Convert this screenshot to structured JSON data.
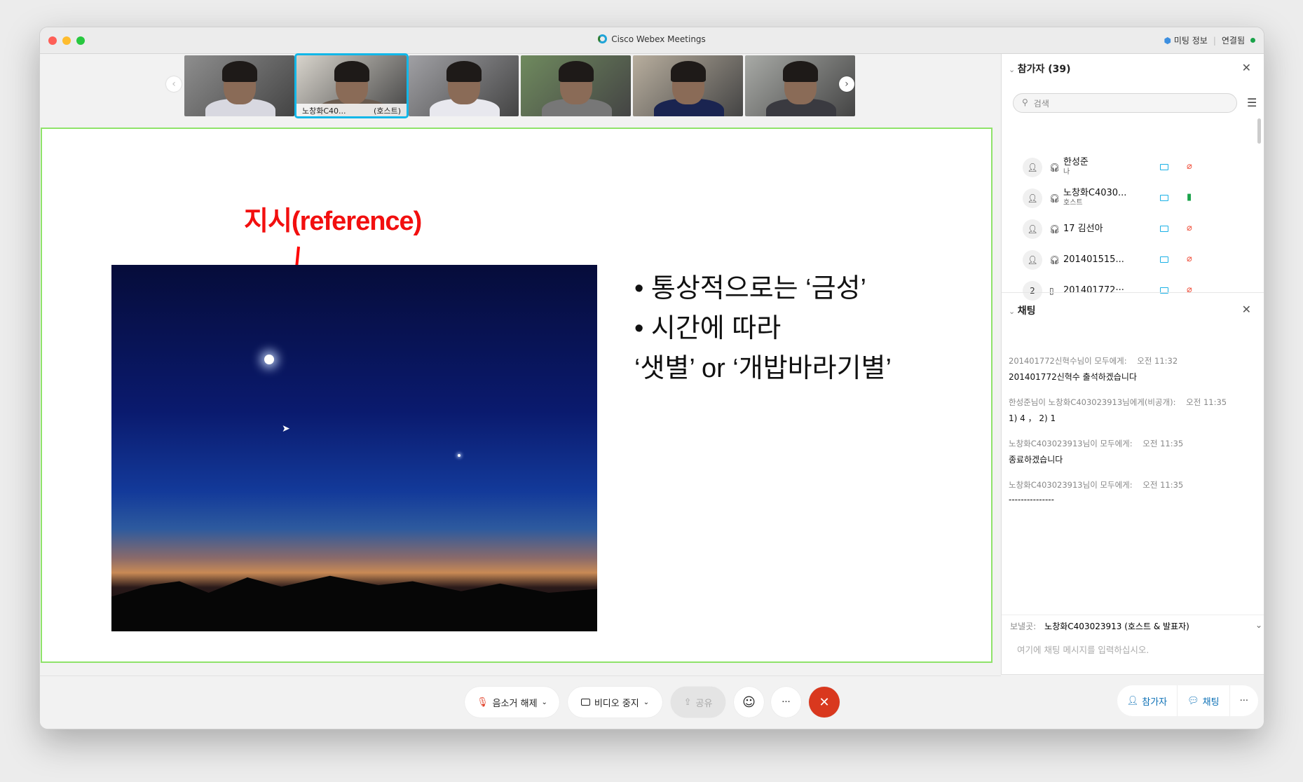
{
  "window": {
    "title": "Cisco Webex Meetings",
    "meeting_info": "미팅 정보",
    "connection_status": "연결됨",
    "status_color": "#1aa34a"
  },
  "thumbnails": [
    {
      "label": "",
      "bg": "#8e8e8e",
      "shirt": "#d8d8e0"
    },
    {
      "label": "노창화C40...",
      "role": "(호스트)",
      "bg": "#d8d4cc",
      "shirt": "#6a5a4e",
      "active": true
    },
    {
      "label": "",
      "bg": "#a0a0a4",
      "shirt": "#e8e8ee"
    },
    {
      "label": "",
      "bg": "#6f8a5e",
      "shirt": "#777"
    },
    {
      "label": "",
      "bg": "#b8ae9e",
      "shirt": "#1a2450"
    },
    {
      "label": "",
      "bg": "#a8aaa6",
      "shirt": "#3a3a40"
    }
  ],
  "slide": {
    "title": "지시(reference)",
    "bullets": [
      "• 통상적으로는 ‘금성’",
      "• 시간에 따라",
      "‘샛별’ or ‘개밥바라기별’"
    ]
  },
  "toolbar": {
    "unmute": "음소거 해제",
    "stop_video": "비디오 중지",
    "share": "공유",
    "more": "···",
    "end_color": "#d9381e"
  },
  "participants": {
    "header": "참가자 (39)",
    "search_placeholder": "검색",
    "list": [
      {
        "avatar": "",
        "name": "한성준",
        "sub": "나",
        "mic": "muted"
      },
      {
        "avatar": "",
        "name": "노창화C4030...",
        "sub": "호스트",
        "mic": "on"
      },
      {
        "avatar": "",
        "name": "17 김선아",
        "sub": "",
        "mic": "muted"
      },
      {
        "avatar": "",
        "name": "201401515...",
        "sub": "",
        "mic": "muted"
      },
      {
        "avatar": "2",
        "name": "201401772···",
        "sub": "",
        "mic": "muted"
      }
    ]
  },
  "chat": {
    "header": "채팅",
    "messages": [
      {
        "from": "201401772신혁수님이 모두에게:",
        "time": "오전 11:32",
        "text": "201401772신혁수 출석하겠습니다"
      },
      {
        "from": "한성준님이 노창화C403023913님에게(비공개):",
        "time": "오전 11:35",
        "text": "1) 4 ， 2) 1"
      },
      {
        "from": "노창화C403023913님이 모두에게:",
        "time": "오전 11:35",
        "text": "종료하겠습니다"
      },
      {
        "from": "노창화C403023913님이 모두에게:",
        "time": "오전 11:35",
        "text": "---------------"
      }
    ],
    "send_to_label": "보낼곳:",
    "send_to": "노창화C403023913 (호스트 & 발표자)",
    "input_placeholder": "여기에 채팅 메시지를 입력하십시오."
  },
  "bottom_right": {
    "participants": "참가자",
    "chat": "채팅",
    "more": "···"
  }
}
